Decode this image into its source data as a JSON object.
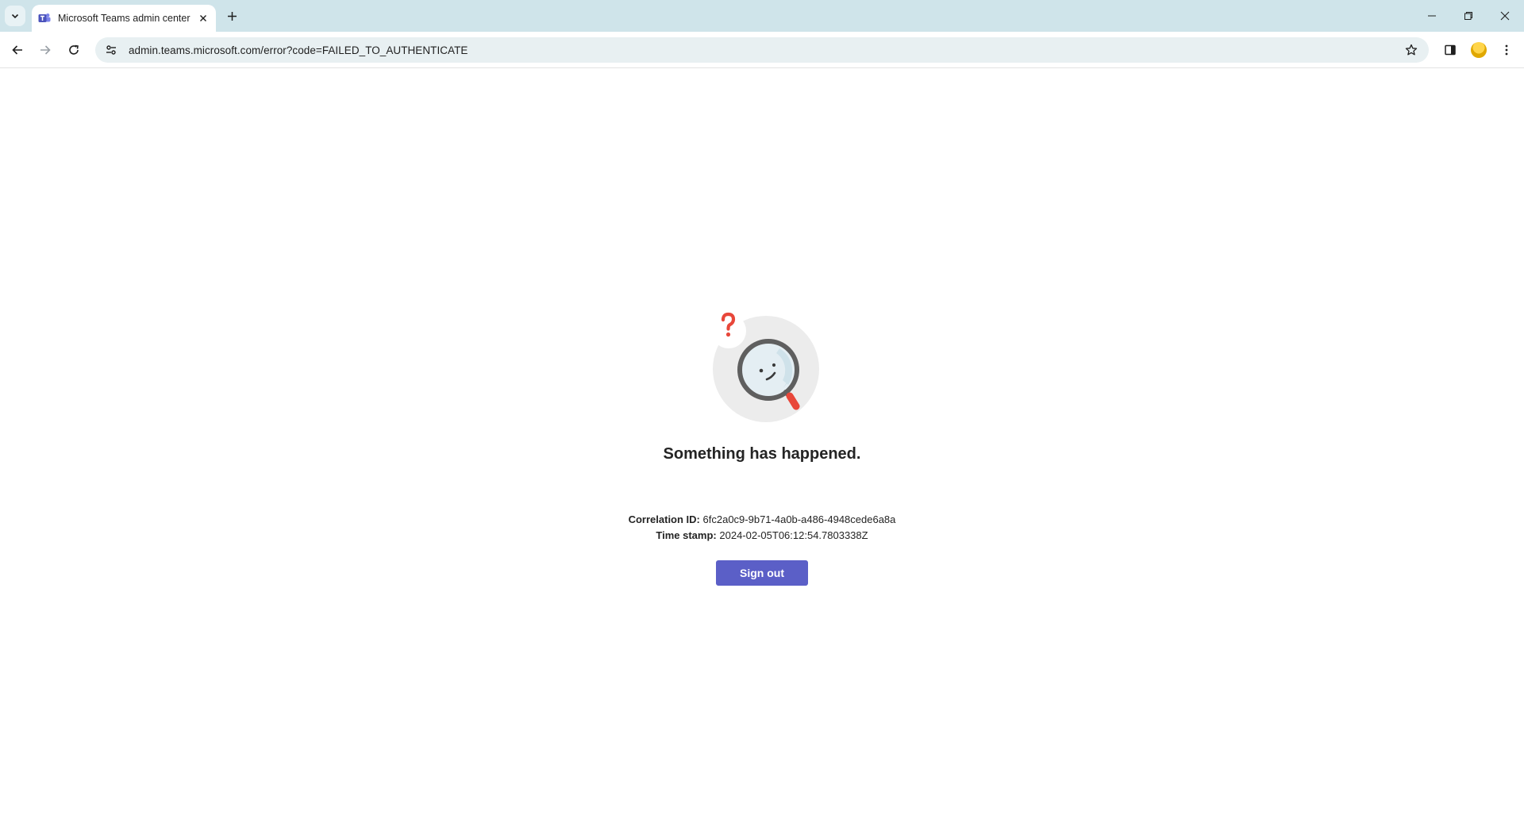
{
  "browser": {
    "tab": {
      "title": "Microsoft Teams admin center",
      "favicon": "teams-icon"
    },
    "url": "admin.teams.microsoft.com/error?code=FAILED_TO_AUTHENTICATE",
    "icons": {
      "tab_search": "chevron-down-icon",
      "close_tab": "close-icon",
      "new_tab": "plus-icon",
      "back": "arrow-left-icon",
      "forward": "arrow-right-icon",
      "reload": "reload-icon",
      "site_info": "tune-icon",
      "bookmark": "star-icon",
      "side_panel": "side-panel-icon",
      "profile": "avatar",
      "menu": "kebab-menu-icon",
      "minimize": "minimize-icon",
      "restore": "restore-icon",
      "close_window": "close-icon"
    }
  },
  "error": {
    "illustration": "magnifier-question-icon",
    "headline": "Something has happened.",
    "correlation_label": "Correlation ID:",
    "correlation_value": "6fc2a0c9-9b71-4a0b-a486-4948cede6a8a",
    "timestamp_label": "Time stamp:",
    "timestamp_value": "2024-02-05T06:12:54.7803338Z",
    "signout_label": "Sign out"
  },
  "colors": {
    "accent": "#5b5fc7",
    "question_mark": "#e8473a",
    "tabstrip": "#cfe4ea",
    "omnibox": "#e8f0f2"
  }
}
